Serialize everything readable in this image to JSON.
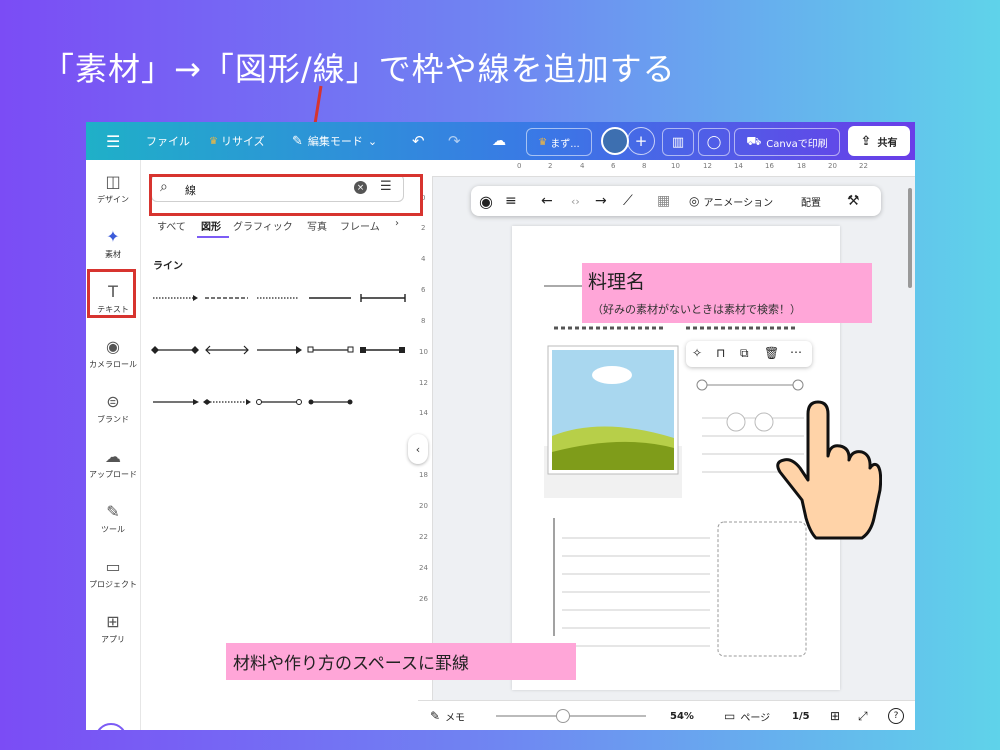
{
  "headline": "「素材」→「図形/線」で枠や線を追加する",
  "toolbar": {
    "file_label": "ファイル",
    "resize_label": "リサイズ",
    "edit_mode_label": "編集モード",
    "brand_label": "まず...",
    "print_label": "Canvaで印刷",
    "share_label": "共有"
  },
  "rail": {
    "items": [
      {
        "label": "デザイン",
        "icon": "design-icon"
      },
      {
        "label": "素材",
        "icon": "elements-icon"
      },
      {
        "label": "テキスト",
        "icon": "text-icon"
      },
      {
        "label": "カメラロール",
        "icon": "camera-icon"
      },
      {
        "label": "ブランド",
        "icon": "brand-icon"
      },
      {
        "label": "アップロード",
        "icon": "upload-icon"
      },
      {
        "label": "ツール",
        "icon": "tools-icon"
      },
      {
        "label": "プロジェクト",
        "icon": "folder-icon"
      },
      {
        "label": "アプリ",
        "icon": "apps-icon"
      }
    ]
  },
  "panel": {
    "search_value": "線",
    "tabs": [
      "すべて",
      "図形",
      "グラフィック",
      "写真",
      "フレーム"
    ],
    "active_tab": "図形",
    "section_title": "ライン"
  },
  "context_toolbar": {
    "animation_label": "アニメーション",
    "arrange_label": "配置"
  },
  "page": {
    "dish_title": "料理名",
    "dish_hint": "（好みの素材がないときは素材で検索！）",
    "ruled_note": "材料や作り方のスペースに罫線"
  },
  "ruler": {
    "top": [
      "0",
      "2",
      "4",
      "6",
      "8",
      "10",
      "12",
      "14",
      "16",
      "18",
      "20",
      "22"
    ],
    "left": [
      "0",
      "2",
      "4",
      "6",
      "8",
      "10",
      "12",
      "14",
      "16",
      "18",
      "20",
      "22",
      "24",
      "26"
    ]
  },
  "bottom": {
    "notes_label": "メモ",
    "zoom": "54%",
    "pages_label": "ページ",
    "page_count": "1/5",
    "help": "?"
  },
  "colors": {
    "highlight_red": "#d7342f",
    "label_pink": "#ffa6d8",
    "accent_purple": "#7c5cf5"
  }
}
